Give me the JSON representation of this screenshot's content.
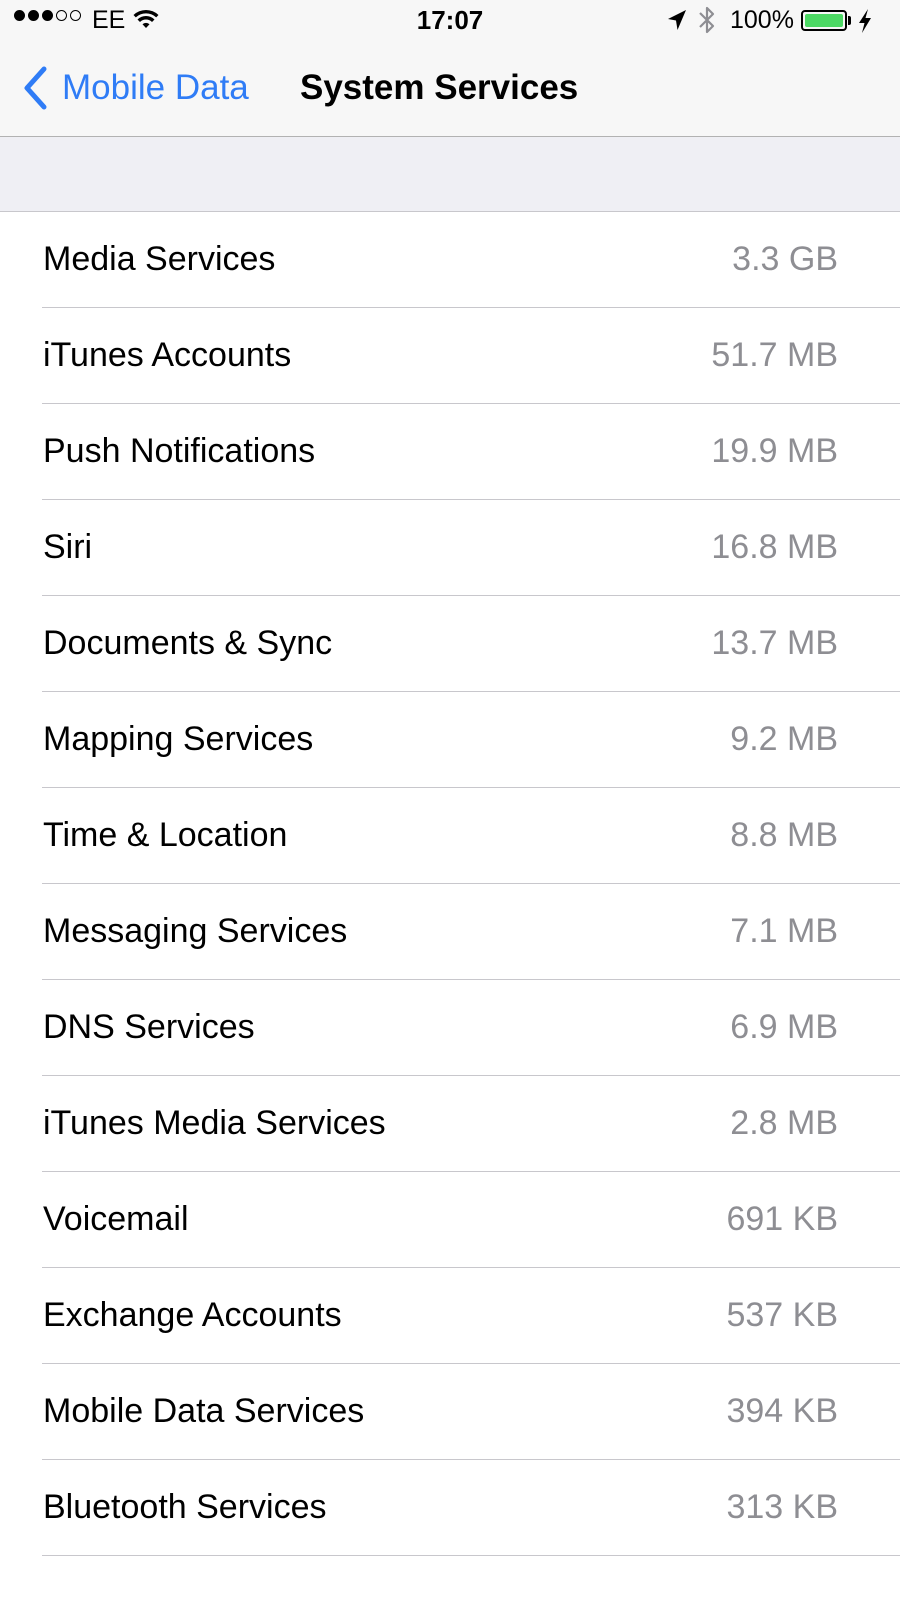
{
  "status_bar": {
    "carrier": "EE",
    "time": "17:07",
    "battery_percent": "100%",
    "signal_bars_filled": 3,
    "signal_bars_total": 5,
    "battery_level": 1.0,
    "battery_color": "#4cd964",
    "icons": [
      "wifi-icon",
      "location-arrow-icon",
      "bluetooth-icon",
      "battery-icon",
      "charging-bolt-icon"
    ]
  },
  "nav": {
    "back_label": "Mobile Data",
    "title": "System Services",
    "accent_color": "#2f7cf6"
  },
  "services": [
    {
      "label": "Media Services",
      "value": "3.3 GB"
    },
    {
      "label": "iTunes Accounts",
      "value": "51.7 MB"
    },
    {
      "label": "Push Notifications",
      "value": "19.9 MB"
    },
    {
      "label": "Siri",
      "value": "16.8 MB"
    },
    {
      "label": "Documents & Sync",
      "value": "13.7 MB"
    },
    {
      "label": "Mapping Services",
      "value": "9.2 MB"
    },
    {
      "label": "Time & Location",
      "value": "8.8 MB"
    },
    {
      "label": "Messaging Services",
      "value": "7.1 MB"
    },
    {
      "label": "DNS Services",
      "value": "6.9 MB"
    },
    {
      "label": "iTunes Media Services",
      "value": "2.8 MB"
    },
    {
      "label": "Voicemail",
      "value": "691 KB"
    },
    {
      "label": "Exchange Accounts",
      "value": "537 KB"
    },
    {
      "label": "Mobile Data Services",
      "value": "394 KB"
    },
    {
      "label": "Bluetooth Services",
      "value": "313 KB"
    }
  ]
}
